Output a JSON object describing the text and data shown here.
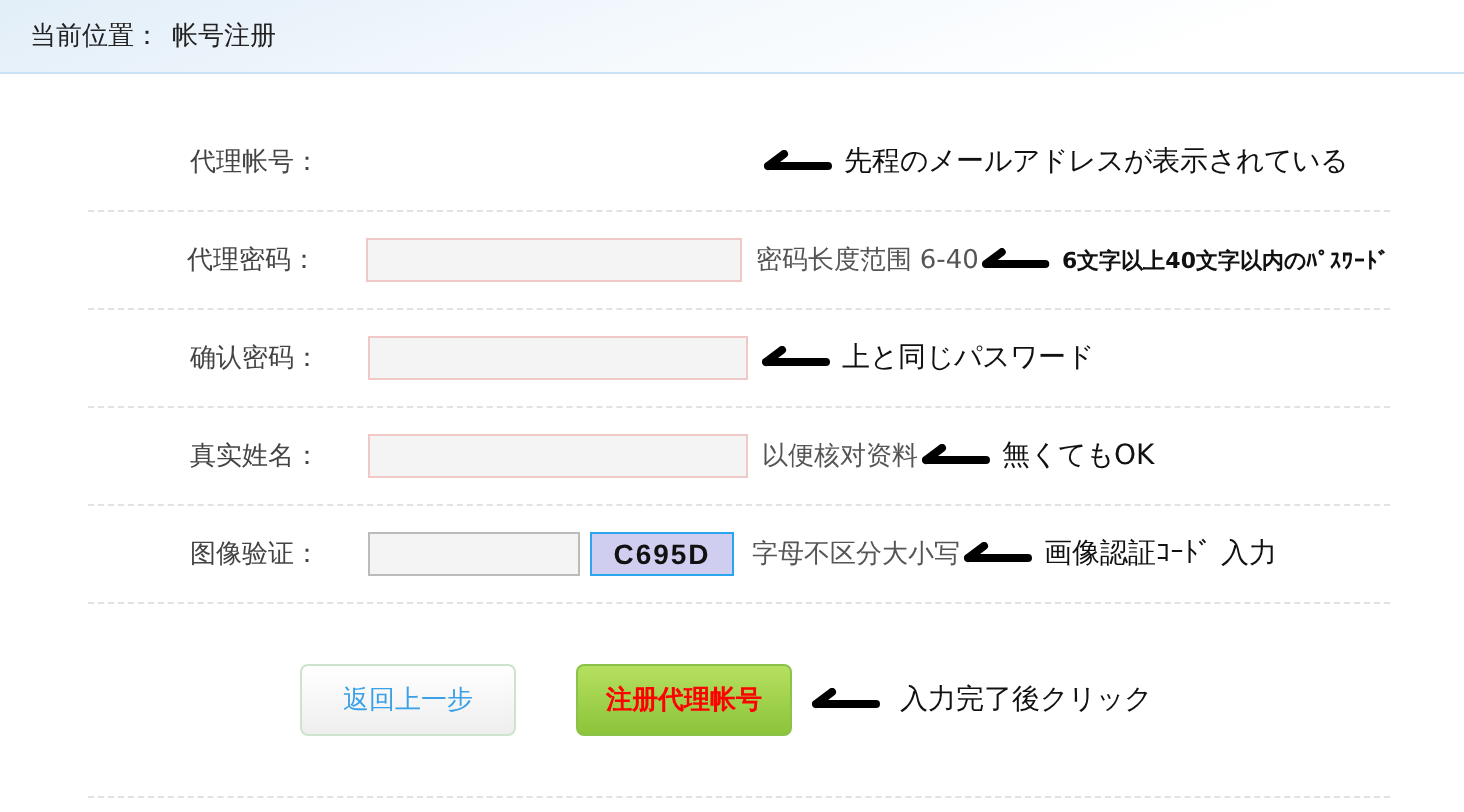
{
  "breadcrumb": {
    "label": "当前位置：",
    "current": "帐号注册"
  },
  "rows": [
    {
      "kind": "text",
      "label": "代理帐号：",
      "note": "先程のメールアドレスが表示されている",
      "small_note": false
    },
    {
      "kind": "input",
      "label": "代理密码：",
      "hint": "密码长度范围 6-40",
      "note": "6文字以上40文字以内のﾊﾟｽﾜｰﾄﾞ",
      "small_note": true
    },
    {
      "kind": "input",
      "label": "确认密码：",
      "note": "上と同じパスワード",
      "small_note": false
    },
    {
      "kind": "input",
      "label": "真实姓名：",
      "hint": "以便核对资料",
      "note": "無くてもOK",
      "small_note": false
    },
    {
      "kind": "captcha",
      "label": "图像验证：",
      "code": "C695D",
      "hint": "字母不区分大小写",
      "note": "画像認証ｺｰﾄﾞ 入力",
      "small_note": false
    }
  ],
  "buttons": [
    {
      "kind": "back",
      "label": "返回上一步"
    },
    {
      "kind": "submit",
      "label": "注册代理帐号"
    }
  ],
  "button_note": "入力完了後クリック"
}
